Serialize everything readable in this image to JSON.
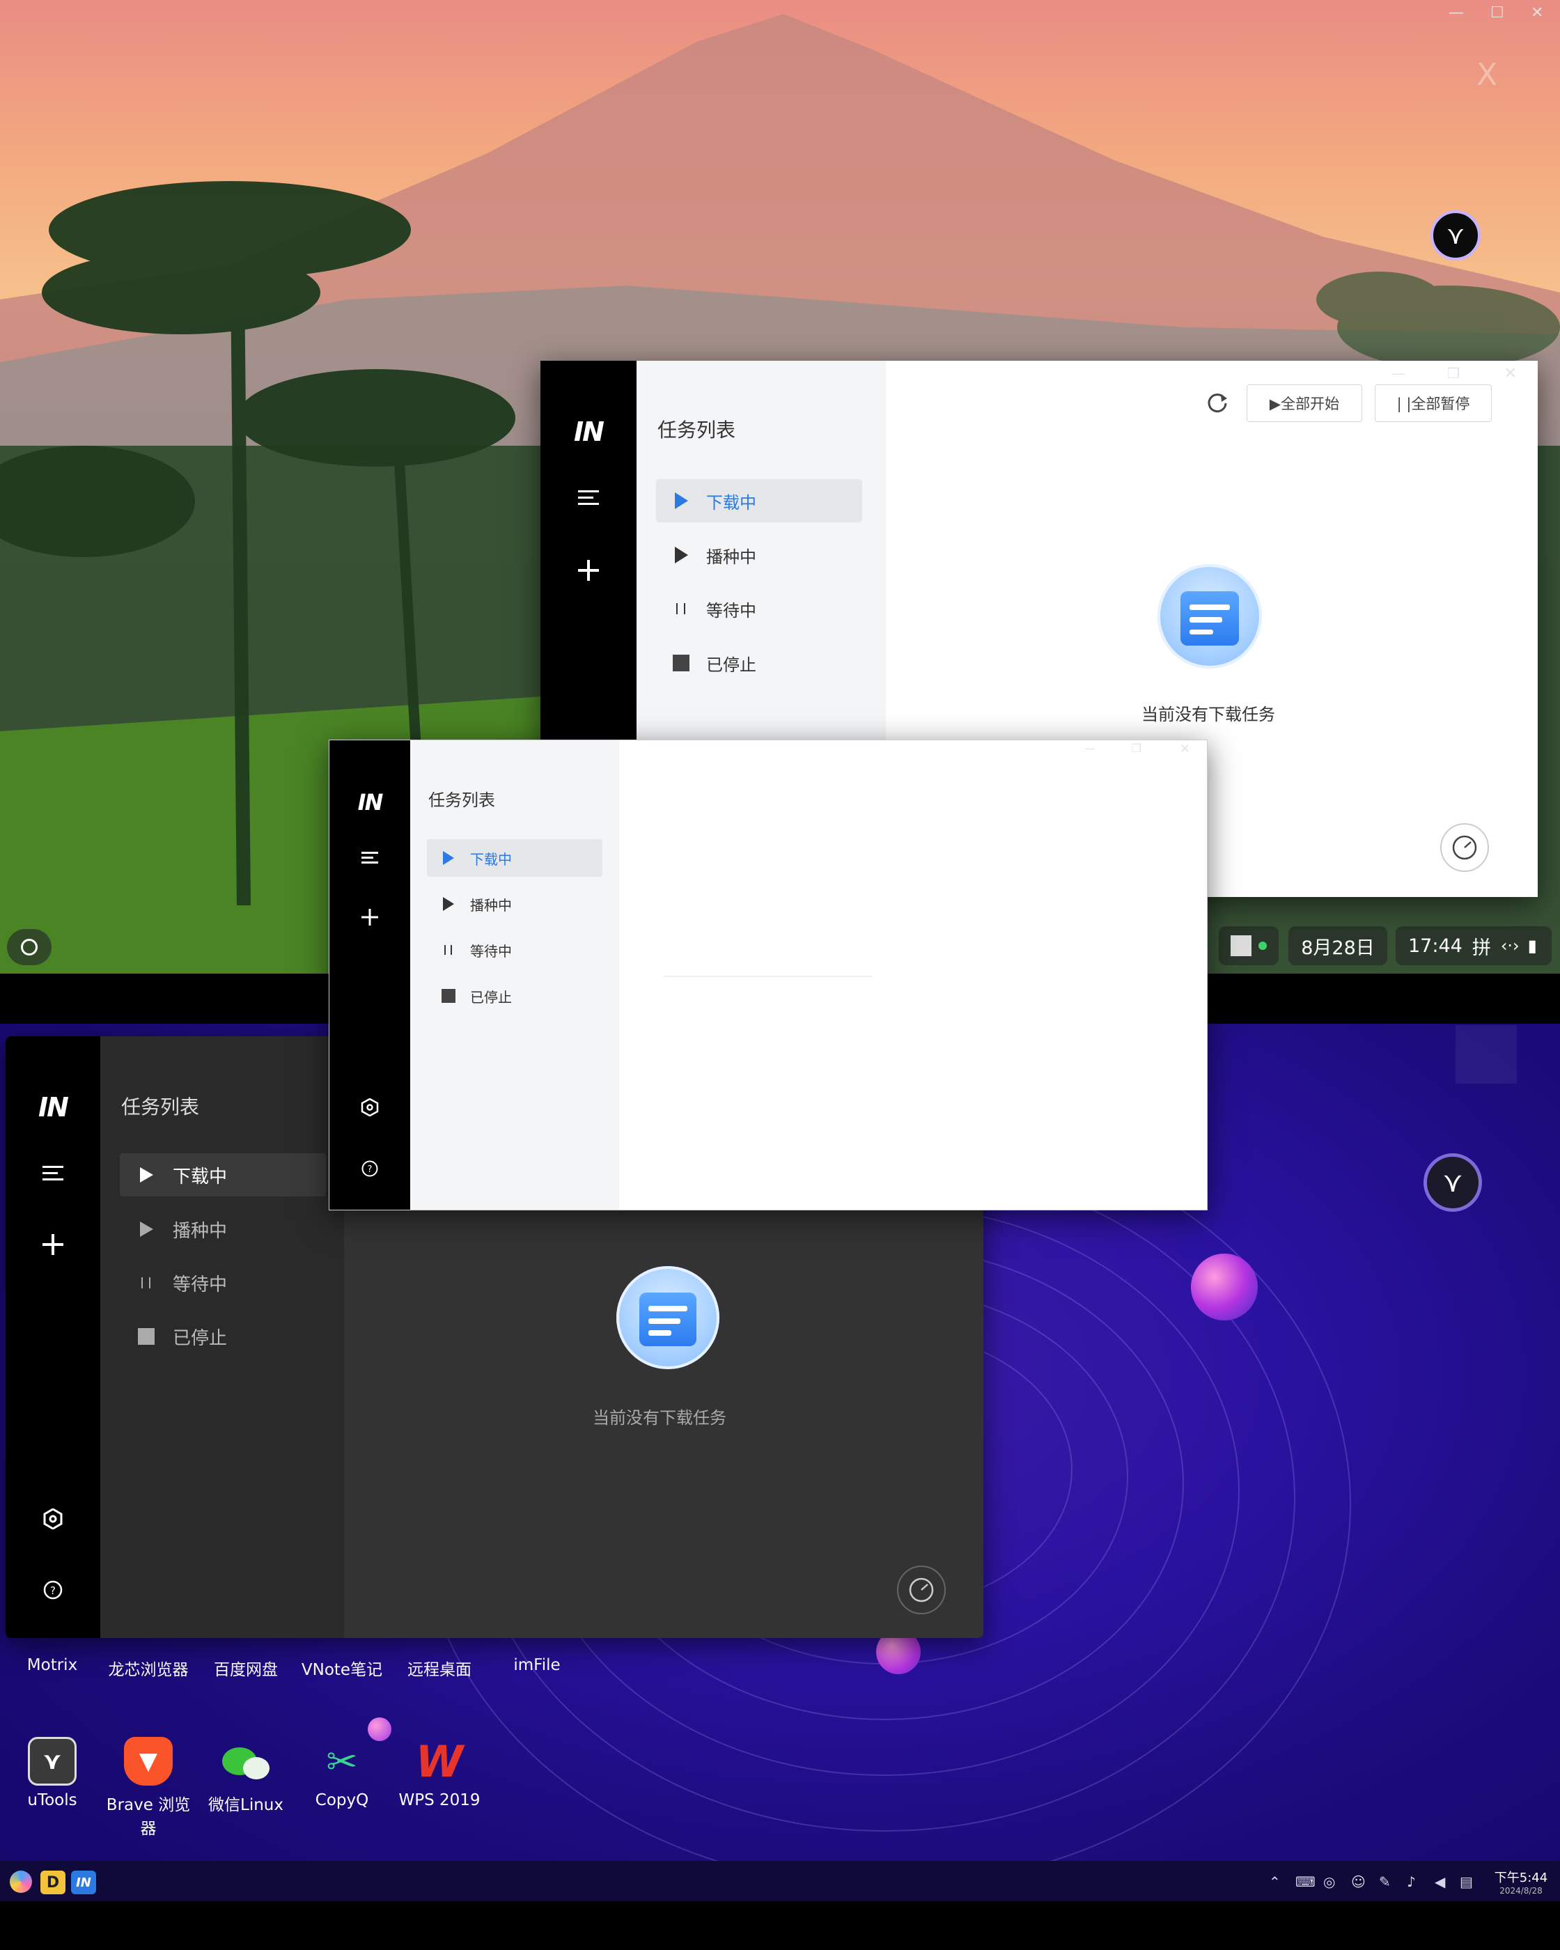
{
  "app": {
    "logo": "IN",
    "panel_title": "任务列表",
    "nav": [
      {
        "label": "下载中",
        "icon": "play-icon"
      },
      {
        "label": "播种中",
        "icon": "play-icon"
      },
      {
        "label": "等待中",
        "icon": "pause-icon"
      },
      {
        "label": "已停止",
        "icon": "stop-icon"
      }
    ],
    "toolbar": {
      "refresh_icon": "refresh-icon",
      "start_all": "▶全部开始",
      "pause_all": "| |全部暂停"
    },
    "empty_message": "当前没有下载任务",
    "rail_icons": [
      "menu-icon",
      "plus-icon",
      "settings-icon",
      "help-icon"
    ],
    "speed_icon": "speedometer-icon"
  },
  "top_taskbar": {
    "date": "8月28日",
    "time": "17:44",
    "ime": "拼",
    "ghost_close": "X"
  },
  "desktop_icons_row1": [
    "Motrix",
    "龙芯浏览器",
    "百度网盘",
    "VNote笔记",
    "远程桌面",
    "imFile"
  ],
  "desktop_icons_row2": [
    {
      "label": "uTools",
      "color": "#3a3a3a"
    },
    {
      "label": "Brave 浏览器",
      "color": "#fb542b"
    },
    {
      "label": "微信Linux",
      "color": "#3bc43b"
    },
    {
      "label": "CopyQ",
      "color": "#3ad18f"
    },
    {
      "label": "WPS 2019",
      "color": "#e8352b"
    }
  ],
  "bottom_taskbar": {
    "time": "下午5:44",
    "date": "2024/8/28",
    "launcher_d": "D",
    "launcher_in": "IN"
  },
  "colors": {
    "accent": "#2a7ae2",
    "rail": "#000000",
    "dark_content": "#333333"
  }
}
